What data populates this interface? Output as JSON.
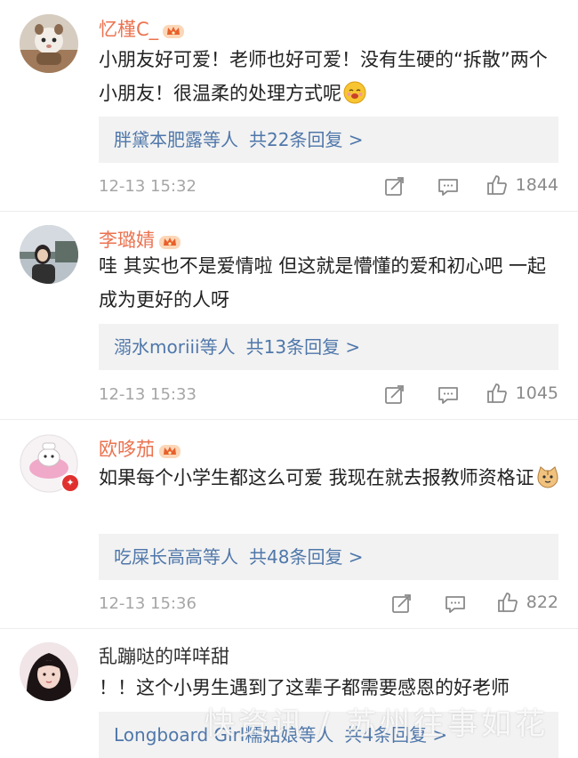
{
  "comments": [
    {
      "username": "忆槿C_",
      "content": "小朋友好可爱！老师也好可爱！没有生硬的“拆散”两个小朋友！很温柔的处理方式呢",
      "emoji": "smiling-blush-emoji",
      "replies_users": "胖黛本肥露等人",
      "replies_count": "共22条回复 >",
      "timestamp": "12-13 15:32",
      "likes": "1844",
      "vip": true
    },
    {
      "username": "李璐婧",
      "content": "哇 其实也不是爱情啦 但这就是懵懂的爱和初心吧 一起成为更好的人呀",
      "replies_users": "溺水moriii等人",
      "replies_count": "共13条回复 >",
      "timestamp": "12-13 15:33",
      "likes": "1045",
      "vip": true
    },
    {
      "username": "欧哆茄",
      "content": "如果每个小学生都这么可爱 我现在就去报教师资格证",
      "emoji": "cat-face-emoji",
      "replies_users": "吃屎长高高等人",
      "replies_count": "共48条回复 >",
      "timestamp": "12-13 15:36",
      "likes": "822",
      "vip": true
    },
    {
      "username": "乱蹦哒的咩咩甜",
      "content": "！！这个小男生遇到了这辈子都需要感恩的好老师",
      "replies_users": "Longboard Girl糯姑娘等人",
      "replies_count": "共4条回复 >"
    }
  ],
  "watermark": "快资讯 / 苏州往事如花",
  "colors": {
    "username": "#eb7350",
    "link": "#4f77aa",
    "meta": "#a6a6a6",
    "reply_bg": "#f2f2f2"
  },
  "icons": {
    "repost": "repost-icon",
    "comment": "comment-icon",
    "like": "like-icon",
    "vip": "vip-crown-icon"
  }
}
